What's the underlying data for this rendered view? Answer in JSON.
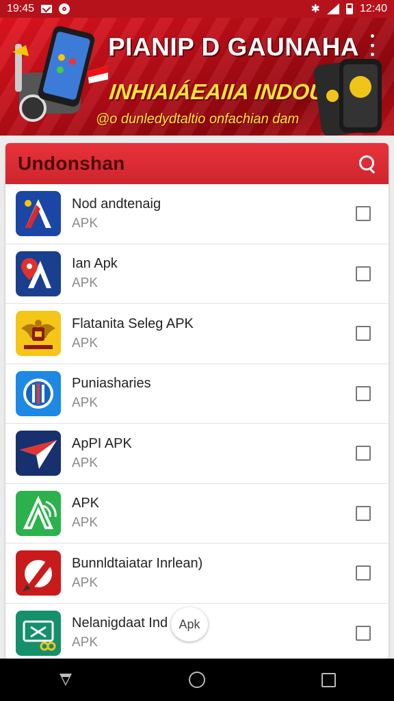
{
  "status_bar": {
    "time_left": "19:45",
    "time_right": "12:40"
  },
  "banner": {
    "title": "PIANIP D GAUNAHA",
    "slogan": "INHIAIÁEAIIA INDOUNI",
    "website": "@o dunledydtaltio onfachian dam"
  },
  "panel": {
    "title": "Undonshan"
  },
  "apps": [
    {
      "name": "Nod andtenaig",
      "type": "APK",
      "icon": "app-a-icon",
      "colors": [
        "#1a47a6",
        "#d92a2a"
      ]
    },
    {
      "name": "Ian Apk",
      "type": "APK",
      "icon": "app-a-pin-icon",
      "colors": [
        "#1b3f8f",
        "#e2302d"
      ]
    },
    {
      "name": "Flatanita Seleg APK",
      "type": "APK",
      "icon": "garuda-emblem-icon",
      "colors": [
        "#f5c518",
        "#8b1a1a"
      ]
    },
    {
      "name": "Puniasharies",
      "type": "APK",
      "icon": "globe-shield-icon",
      "colors": [
        "#1e88e5",
        "#ffffff"
      ]
    },
    {
      "name": "ApPI APK",
      "type": "APK",
      "icon": "paper-plane-icon",
      "colors": [
        "#17306e",
        "#e33434"
      ]
    },
    {
      "name": "APK",
      "type": "APK",
      "icon": "green-a-icon",
      "colors": [
        "#2bb24c",
        "#ffffff"
      ]
    },
    {
      "name": "Bunnldtaiatar Inrlean)",
      "type": "APK",
      "icon": "pen-icon",
      "colors": [
        "#c91b1b",
        "#ffffff"
      ]
    },
    {
      "name": "Nelanigdaat Ind",
      "type": "APK",
      "icon": "ticket-icon",
      "colors": [
        "#14906a",
        "#f5c518"
      ]
    }
  ],
  "bubble": {
    "label": "Apk"
  }
}
